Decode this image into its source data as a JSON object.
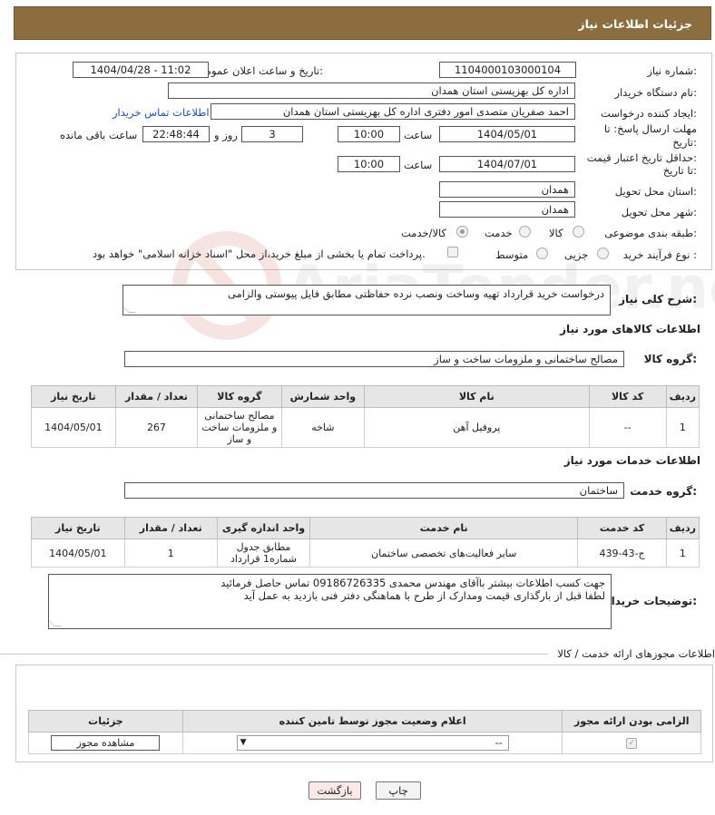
{
  "header": {
    "title": "جزئیات اطلاعات نیاز"
  },
  "need_info": {
    "need_number_label": "شماره نیاز:",
    "need_number": "1104000103000104",
    "announce_label": "تاریخ و ساعت اعلان عمومی:",
    "announce_value": "1404/04/28 - 11:02",
    "buyer_org_label": "نام دستگاه خریدار:",
    "buyer_org": "اداره کل بهزیستی استان همدان",
    "requester_label": "ایجاد کننده درخواست:",
    "requester": "احمد صفریان متصدی امور دفتری اداره کل بهزیستی استان همدان",
    "contact_link": "اطلاعات تماس خریدار",
    "deadline_label_1": "مهلت ارسال پاسخ: تا",
    "deadline_label_2": "تاریخ:",
    "deadline_date": "1404/05/01",
    "time_label": "ساعت",
    "deadline_time": "10:00",
    "days_value": "3",
    "days_label": "روز و",
    "remaining_time": "22:48:44",
    "remaining_label": "ساعت باقی مانده",
    "validity_label_1": "حداقل تاریخ اعتبار قیمت:",
    "validity_label_2": "تا تاریخ:",
    "validity_date": "1404/07/01",
    "validity_time": "10:00",
    "province_label": "استان محل تحویل:",
    "province": "همدان",
    "city_label": "شهر محل تحویل:",
    "city": "همدان",
    "category_label": "طبقه بندی موضوعی:",
    "category_options": [
      "کالا",
      "خدمت",
      "کالا/خدمت"
    ],
    "process_label": "نوع فرآیند خرید :",
    "process_options": [
      "جزیی",
      "متوسط"
    ],
    "payment_note": "پرداخت تمام یا بخشی از مبلغ خرید،از محل \"اسناد خزانه اسلامی\" خواهد بود."
  },
  "description": {
    "label": "شرح کلی نیاز:",
    "text": "درخواست خرید قرارداد تهیه وساخت ونصب نرده حفاظتی مطابق فایل پیوستی والزامی"
  },
  "goods": {
    "title": "اطلاعات کالاهای مورد نیاز",
    "group_label": "گروه کالا:",
    "group_value": "مصالح ساختمانی و ملزومات ساخت و ساز",
    "columns": [
      "ردیف",
      "کد کالا",
      "نام کالا",
      "واحد شمارش",
      "گروه کالا",
      "تعداد / مقدار",
      "تاریخ نیاز"
    ],
    "rows": [
      [
        "1",
        "--",
        "پروفیل آهن",
        "شاخه",
        "مصالح ساختمانی و ملزومات ساخت و ساز",
        "267",
        "1404/05/01"
      ]
    ]
  },
  "services": {
    "title": "اطلاعات خدمات مورد نیاز",
    "group_label": "گروه خدمت:",
    "group_value": "ساختمان",
    "columns": [
      "ردیف",
      "کد خدمت",
      "نام خدمت",
      "واحد اندازه گیری",
      "تعداد / مقدار",
      "تاریخ نیاز"
    ],
    "rows": [
      [
        "1",
        "ج-43-439",
        "سایر فعالیت‌های تخصصی ساختمان",
        "مطابق جدول شماره1 قرارداد",
        "1",
        "1404/05/01"
      ]
    ]
  },
  "buyer_notes": {
    "label": "توضیحات خریدار:",
    "line1": "جهت کسب اطلاعات بیشتر باآقای مهندس محمدی 09186726335 تماس حاصل فرمائید",
    "line2": "لطفا قبل از بارگذاری قیمت ومدارک از طرح با هماهنگی دفتر فنی بازدید به عمل آید"
  },
  "permits": {
    "title": "اطلاعات مجوزهای ارائه خدمت / کالا",
    "columns": [
      "الزامی بودن ارائه مجوز",
      "اعلام وضعیت مجوز توسط تامین کننده",
      "جزئیات"
    ],
    "select_value": "--",
    "view_button": "مشاهده مجوز"
  },
  "footer": {
    "print_button": "چاپ",
    "back_button": "بازگشت"
  },
  "watermark_text": "AriaTender.neT",
  "colors": {
    "header_bg": "#8c6d3f",
    "link": "#1a4fb5",
    "back_button_bg": "#fde8e8"
  }
}
